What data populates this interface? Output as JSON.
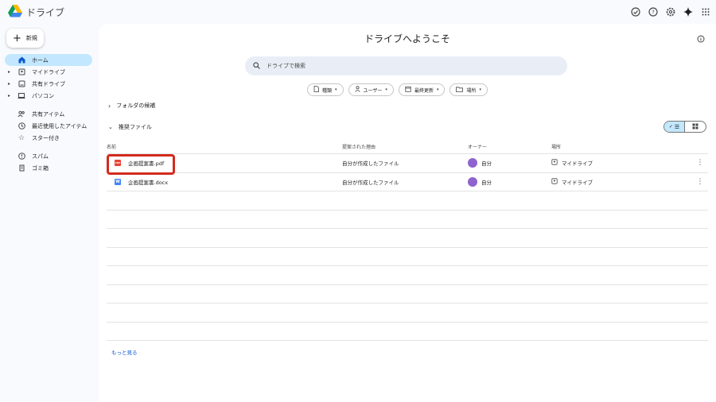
{
  "app": {
    "title": "ドライブ"
  },
  "topbar": {
    "icons": [
      "offline-status-icon",
      "help-icon",
      "settings-icon",
      "gemini-sparkle-icon",
      "apps-grid-icon"
    ]
  },
  "new_button": {
    "label": "新規"
  },
  "sidebar": {
    "items": [
      {
        "label": "ホーム",
        "icon": "home-icon",
        "active": true,
        "caret": false
      },
      {
        "label": "マイドライブ",
        "icon": "my-drive-icon",
        "caret": true
      },
      {
        "label": "共有ドライブ",
        "icon": "shared-drive-icon",
        "caret": true
      },
      {
        "label": "パソコン",
        "icon": "computer-icon",
        "caret": true
      },
      {
        "label": "共有アイテム",
        "icon": "people-icon"
      },
      {
        "label": "最近使用したアイテム",
        "icon": "clock-icon"
      },
      {
        "label": "スター付き",
        "icon": "star-icon"
      },
      {
        "label": "スパム",
        "icon": "spam-icon"
      },
      {
        "label": "ゴミ箱",
        "icon": "trash-icon"
      }
    ]
  },
  "main": {
    "welcome": "ドライブへようこそ",
    "search": {
      "placeholder": "ドライブで検索"
    },
    "filters": [
      {
        "label": "種類",
        "icon": "file-icon"
      },
      {
        "label": "ユーザー",
        "icon": "person-icon"
      },
      {
        "label": "最終更新",
        "icon": "calendar-icon"
      },
      {
        "label": "場所",
        "icon": "folder-icon"
      }
    ],
    "folder_section": "フォルダの候補",
    "files_section": "推奨ファイル",
    "columns": {
      "name": "名前",
      "reason": "提案された理由",
      "owner": "オーナー",
      "location": "場所"
    },
    "rows": [
      {
        "name": "企画提案書.pdf",
        "type": "pdf",
        "type_badge": "PDF",
        "reason": "自分が作成したファイル",
        "owner": "自分",
        "location": "マイドライブ"
      },
      {
        "name": "企画提案書.docx",
        "type": "doc",
        "type_badge": "W",
        "reason": "自分が作成したファイル",
        "owner": "自分",
        "location": "マイドライブ"
      }
    ],
    "more_link": "もっと見る"
  },
  "colors": {
    "accent": "#c2e7ff",
    "highlight": "#d32b1e",
    "link": "#0b57d0",
    "avatar": "#8e63ce"
  }
}
